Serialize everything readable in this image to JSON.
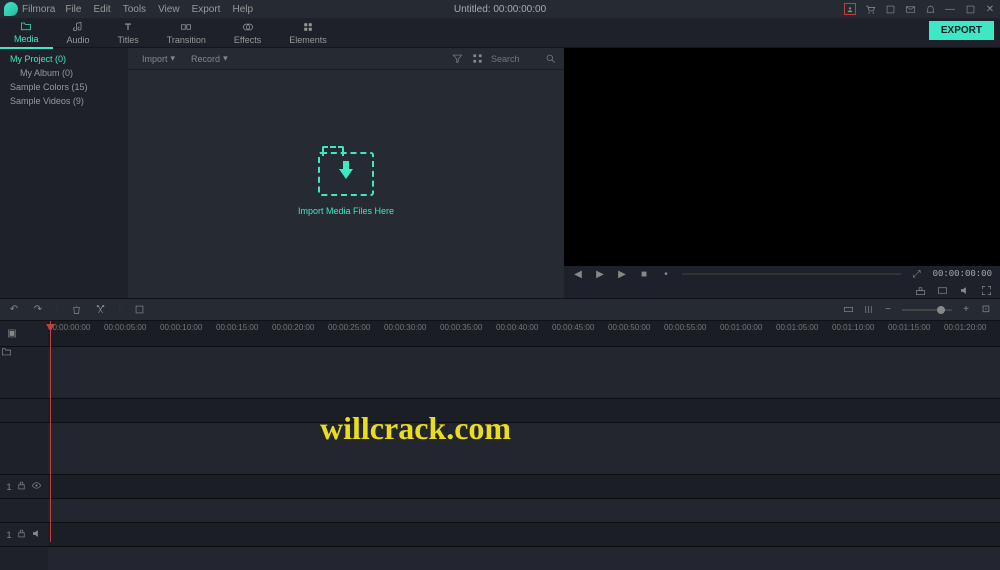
{
  "app": {
    "name": "Filmora",
    "title": "Untitled:  00:00:00:00"
  },
  "menu": [
    "File",
    "Edit",
    "Tools",
    "View",
    "Export",
    "Help"
  ],
  "tabs": [
    {
      "id": "media",
      "label": "Media",
      "active": true
    },
    {
      "id": "audio",
      "label": "Audio"
    },
    {
      "id": "titles",
      "label": "Titles"
    },
    {
      "id": "transition",
      "label": "Transition"
    },
    {
      "id": "effects",
      "label": "Effects"
    },
    {
      "id": "elements",
      "label": "Elements"
    }
  ],
  "export_label": "EXPORT",
  "sidebar": {
    "items": [
      {
        "label": "My Project (0)",
        "active": true
      },
      {
        "label": "My Album (0)",
        "sub": true
      },
      {
        "label": "Sample Colors (15)"
      },
      {
        "label": "Sample Videos (9)"
      }
    ]
  },
  "media_toolbar": {
    "import": "Import",
    "record": "Record",
    "search_ph": "Search"
  },
  "dropzone_label": "Import Media Files Here",
  "preview": {
    "timecode": "00:00:00:00"
  },
  "ruler_marks": [
    "00:00:00:00",
    "00:00:05:00",
    "00:00:10:00",
    "00:00:15:00",
    "00:00:20:00",
    "00:00:25:00",
    "00:00:30:00",
    "00:00:35:00",
    "00:00:40:00",
    "00:00:45:00",
    "00:00:50:00",
    "00:00:55:00",
    "00:01:00:00",
    "00:01:05:00",
    "00:01:10:00",
    "00:01:15:00",
    "00:01:20:00"
  ],
  "track_labels": {
    "video": "1",
    "audio": "1"
  },
  "watermark": "willcrack.com"
}
